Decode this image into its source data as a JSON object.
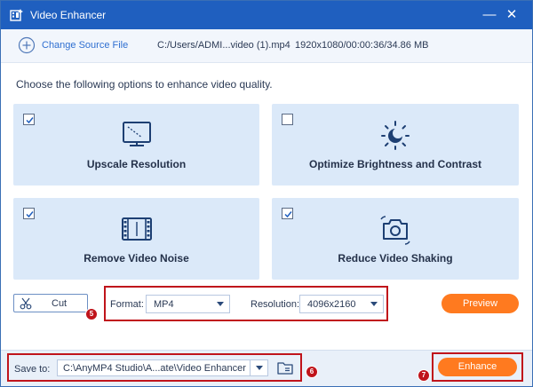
{
  "window": {
    "title": "Video Enhancer",
    "minimize_glyph": "—",
    "close_glyph": "✕"
  },
  "file": {
    "change_source_label": "Change Source File",
    "path": "C:/Users/ADMI...video (1).mp4",
    "info": "1920x1080/00:00:36/34.86 MB"
  },
  "instruction": "Choose the following options to enhance video quality.",
  "options": [
    {
      "label": "Upscale Resolution",
      "checked": true,
      "icon": "upscale-icon"
    },
    {
      "label": "Optimize Brightness and Contrast",
      "checked": false,
      "icon": "brightness-icon"
    },
    {
      "label": "Remove Video Noise",
      "checked": true,
      "icon": "film-noise-icon"
    },
    {
      "label": "Reduce Video Shaking",
      "checked": true,
      "icon": "camera-shake-icon"
    }
  ],
  "controls": {
    "cut_label": "Cut",
    "format_label": "Format:",
    "format_value": "MP4",
    "resolution_label": "Resolution:",
    "resolution_value": "4096x2160",
    "preview_label": "Preview"
  },
  "save": {
    "label": "Save to:",
    "path": "C:\\AnyMP4 Studio\\A...ate\\Video Enhancer"
  },
  "enhance_label": "Enhance",
  "badges": [
    "5",
    "6",
    "7"
  ],
  "colors": {
    "titlebar": "#1f5fbf",
    "accent_orange": "#ff7a1f",
    "card_bg": "#dbe9f9",
    "highlight_red": "#c0141b",
    "link_blue": "#2f6fd1"
  }
}
